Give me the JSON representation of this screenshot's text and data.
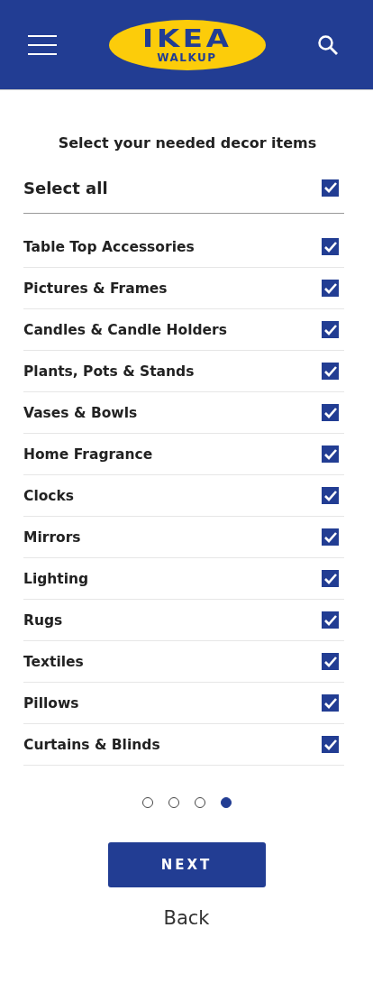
{
  "header": {
    "logo": {
      "name": "IKEA",
      "subtitle": "WALKUP"
    }
  },
  "title": "Select your needed decor items",
  "select_all": {
    "label": "Select all",
    "checked": true
  },
  "items": [
    {
      "label": "Table Top Accessories",
      "checked": true
    },
    {
      "label": "Pictures & Frames",
      "checked": true
    },
    {
      "label": "Candles & Candle Holders",
      "checked": true
    },
    {
      "label": "Plants, Pots & Stands",
      "checked": true
    },
    {
      "label": "Vases & Bowls",
      "checked": true
    },
    {
      "label": "Home Fragrance",
      "checked": true
    },
    {
      "label": "Clocks",
      "checked": true
    },
    {
      "label": "Mirrors",
      "checked": true
    },
    {
      "label": "Lighting",
      "checked": true
    },
    {
      "label": "Rugs",
      "checked": true
    },
    {
      "label": "Textiles",
      "checked": true
    },
    {
      "label": "Pillows",
      "checked": true
    },
    {
      "label": "Curtains & Blinds",
      "checked": true
    }
  ],
  "pager": [
    {
      "selected": false
    },
    {
      "selected": false
    },
    {
      "selected": false
    },
    {
      "selected": true
    }
  ],
  "buttons": {
    "next": "NEXT",
    "back": "Back"
  }
}
